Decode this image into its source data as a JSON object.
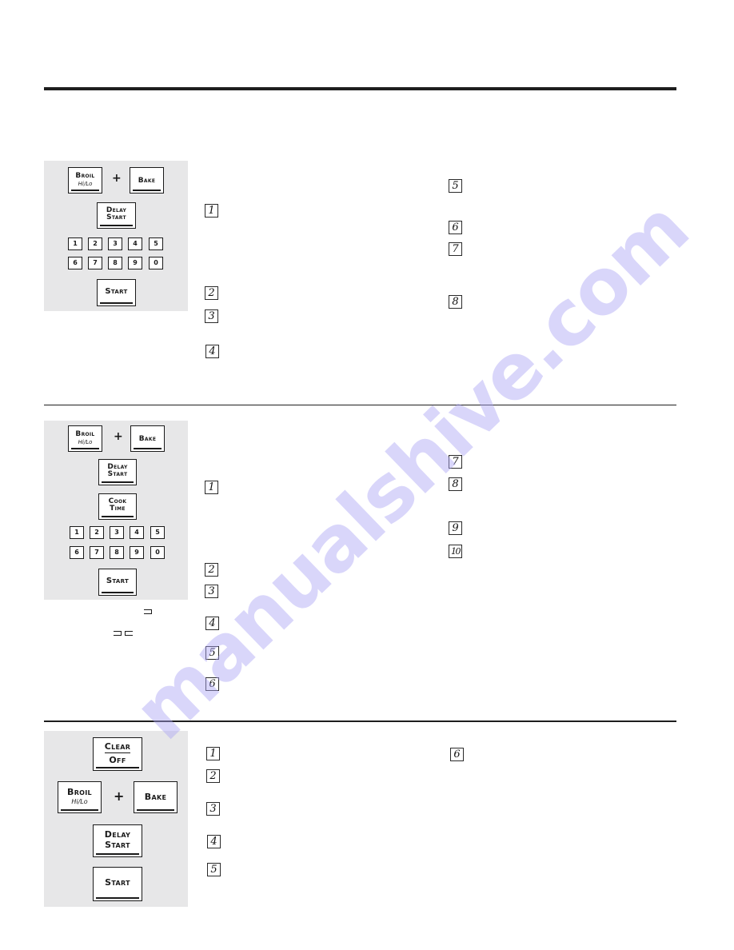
{
  "page": {
    "sections": [
      {
        "id": "section-1",
        "panel": {
          "keys": {
            "broil": {
              "label": "Broil",
              "sub": "Hi/Lo"
            },
            "plus": "+",
            "bake": {
              "label": "Bake"
            },
            "delay_start": {
              "line1": "Delay",
              "line2": "Start"
            },
            "start": {
              "label": "Start"
            }
          },
          "number_pad": [
            "1",
            "2",
            "3",
            "4",
            "5",
            "6",
            "7",
            "8",
            "9",
            "0"
          ]
        },
        "steps_left": [
          "1",
          "2",
          "3",
          "4"
        ],
        "steps_right": [
          "5",
          "6",
          "7",
          "8"
        ]
      },
      {
        "id": "section-2",
        "panel": {
          "keys": {
            "broil": {
              "label": "Broil",
              "sub": "Hi/Lo"
            },
            "plus": "+",
            "bake": {
              "label": "Bake"
            },
            "delay_start": {
              "line1": "Delay",
              "line2": "Start"
            },
            "cook_time": {
              "line1": "Cook",
              "line2": "Time"
            },
            "start": {
              "label": "Start"
            }
          },
          "number_pad": [
            "1",
            "2",
            "3",
            "4",
            "5",
            "6",
            "7",
            "8",
            "9",
            "0"
          ]
        },
        "steps_left": [
          "1",
          "2",
          "3",
          "4",
          "5",
          "6"
        ],
        "steps_right": [
          "7",
          "8",
          "9",
          "10"
        ]
      },
      {
        "id": "section-3",
        "panel": {
          "keys": {
            "clear_off": {
              "line1": "Clear",
              "line2": "Off"
            },
            "broil": {
              "label": "Broil",
              "sub": "Hi/Lo"
            },
            "plus": "+",
            "bake": {
              "label": "Bake"
            },
            "delay_start": {
              "line1": "Delay",
              "line2": "Start"
            },
            "start": {
              "label": "Start"
            }
          }
        },
        "steps_left": [
          "1",
          "2",
          "3",
          "4",
          "5"
        ],
        "steps_right": [
          "6"
        ]
      }
    ],
    "watermark": "manualshive.com"
  }
}
